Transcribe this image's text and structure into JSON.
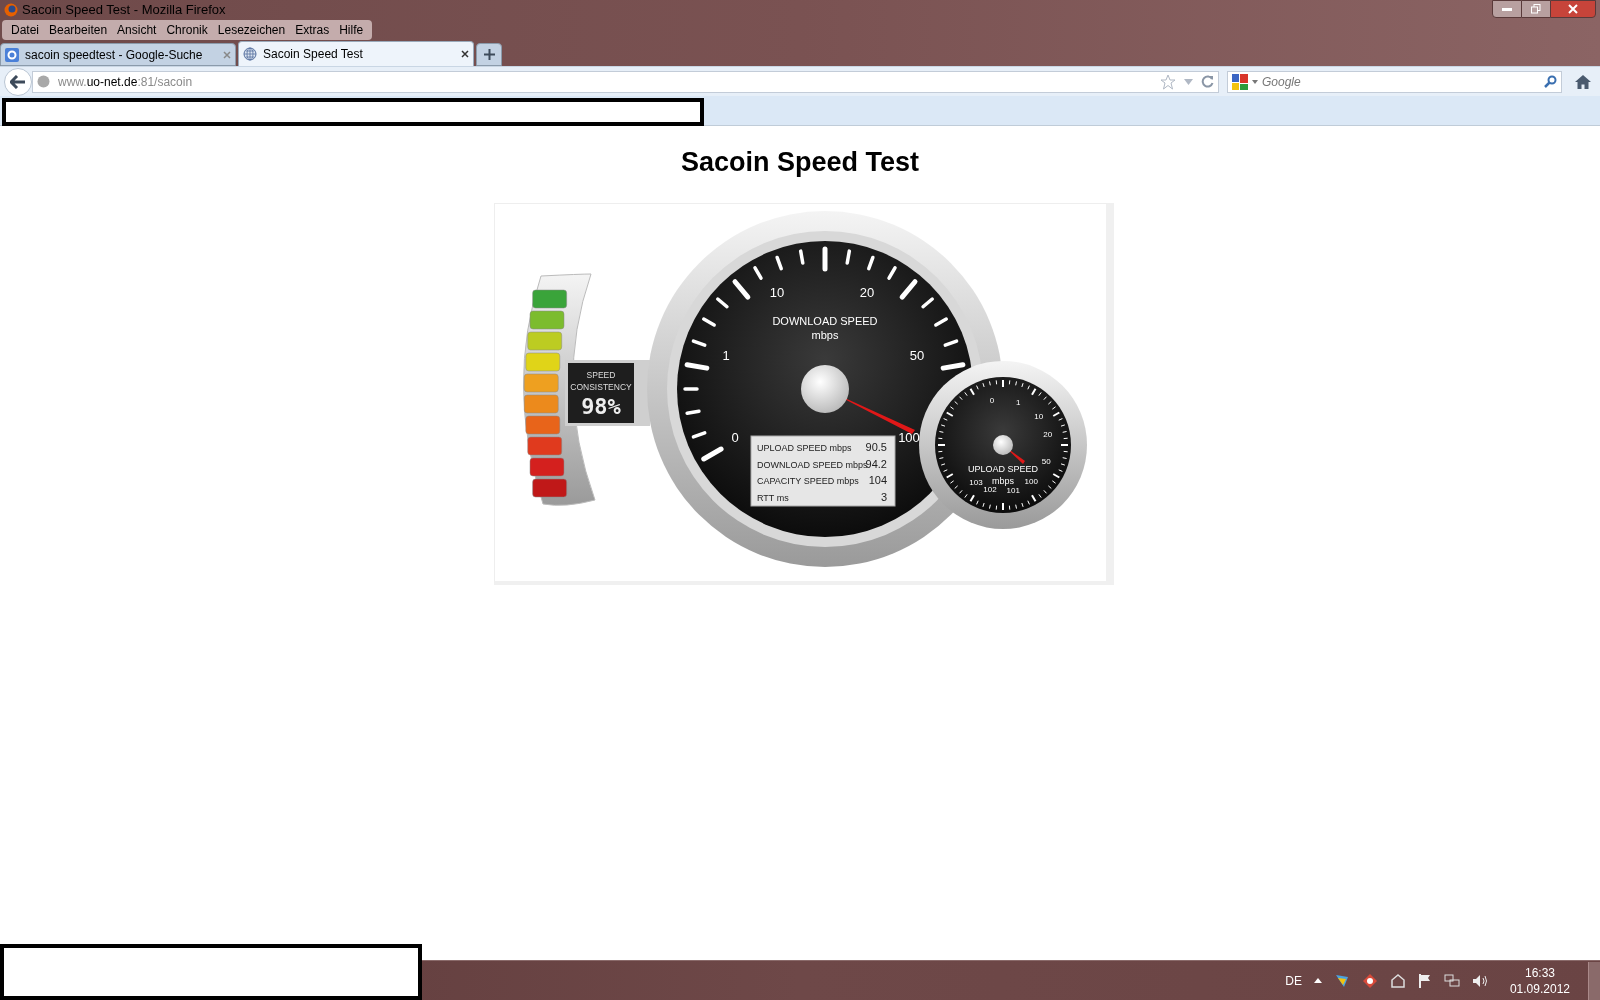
{
  "window": {
    "title": "Sacoin Speed Test - Mozilla Firefox"
  },
  "menu": [
    "Datei",
    "Bearbeiten",
    "Ansicht",
    "Chronik",
    "Lesezeichen",
    "Extras",
    "Hilfe"
  ],
  "tabs": [
    {
      "label": "sacoin speedtest - Google-Suche",
      "selected": false,
      "kind": "google"
    },
    {
      "label": "Sacoin Speed Test",
      "selected": true,
      "kind": "globe"
    }
  ],
  "address": {
    "prefix": "www.",
    "domain": "uo-net.de",
    "suffix": ":81/sacoin"
  },
  "search": {
    "placeholder": "Google"
  },
  "page": {
    "heading": "Sacoin Speed Test",
    "consistency": {
      "label_1": "SPEED",
      "label_2": "CONSISTENCY",
      "reading": "98%"
    },
    "download_dial": {
      "title": "DOWNLOAD SPEED",
      "unit": "mbps",
      "ticks": [
        "0",
        "1",
        "10",
        "20",
        "50",
        "100"
      ]
    },
    "upload_dial": {
      "title": "UPLOAD SPEED",
      "unit": "mbps",
      "ticks": [
        "0",
        "1",
        "10",
        "20",
        "50",
        "100",
        "101",
        "102",
        "103"
      ]
    },
    "results": [
      {
        "label": "UPLOAD SPEED mbps",
        "value": "90.5"
      },
      {
        "label": "DOWNLOAD SPEED mbps",
        "value": "94.2"
      },
      {
        "label": "CAPACITY SPEED mbps",
        "value": "104"
      },
      {
        "label": "RTT ms",
        "value": "3"
      }
    ]
  },
  "taskbar": {
    "language": "DE",
    "time": "16:33",
    "date": "01.09.2012"
  }
}
